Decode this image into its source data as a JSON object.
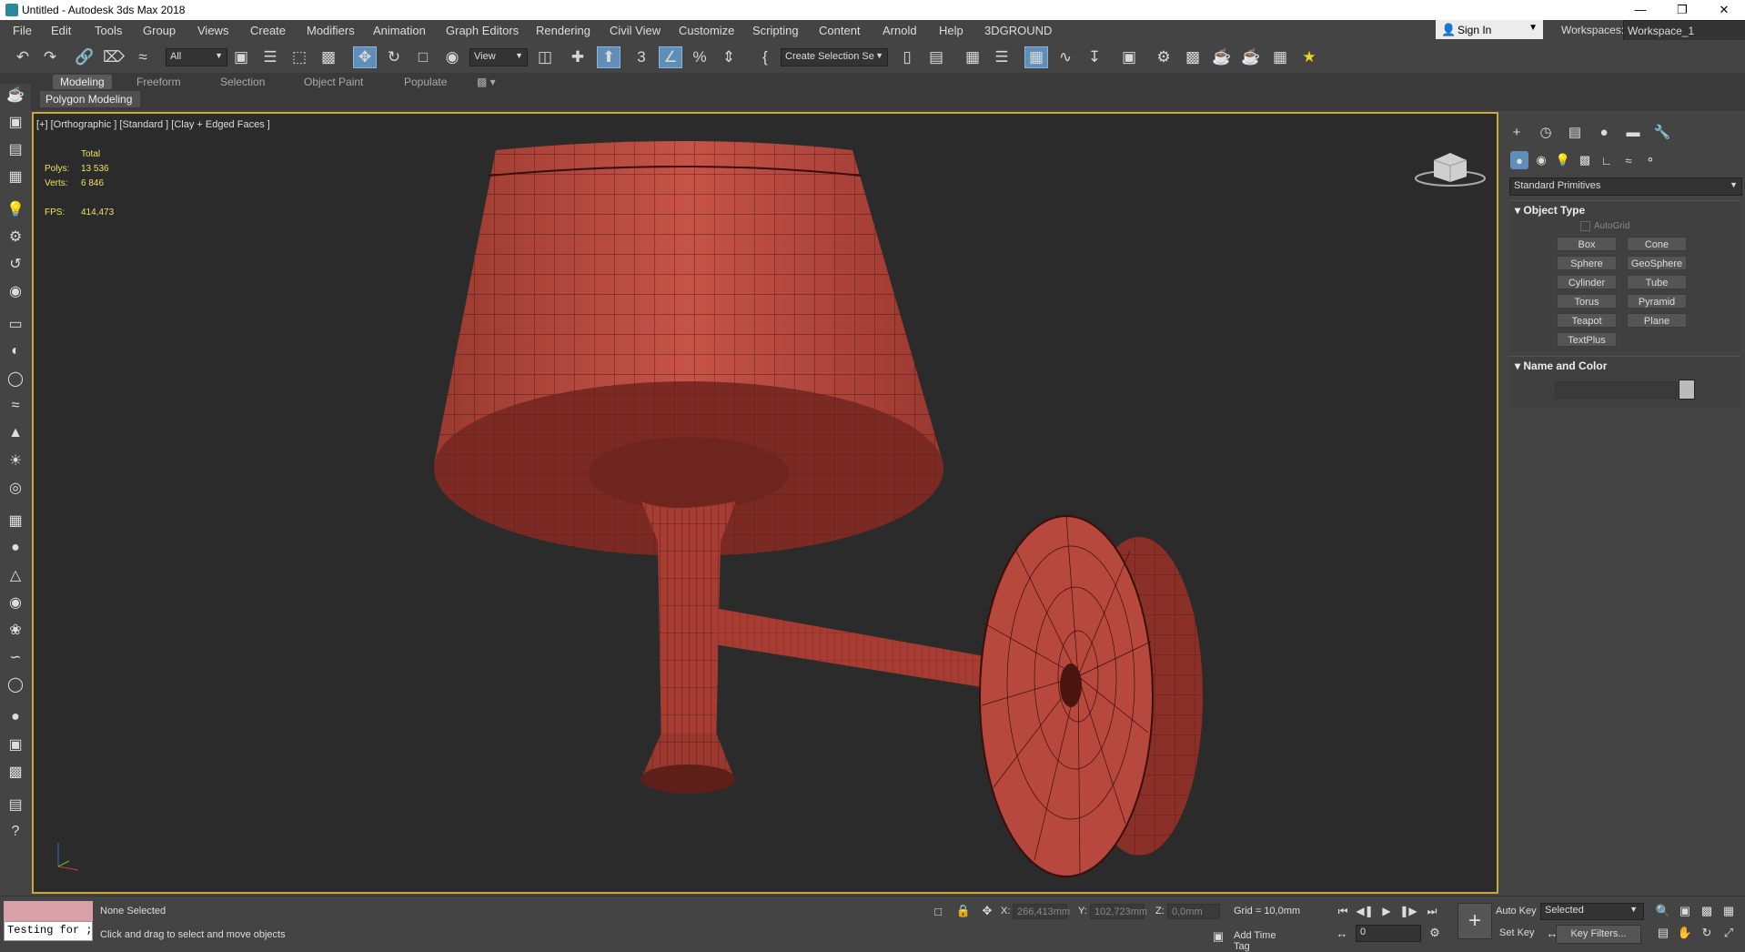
{
  "window": {
    "title": "Untitled - Autodesk 3ds Max 2018",
    "minimize": "—",
    "restore": "❐",
    "close": "✕"
  },
  "menubar": {
    "items": [
      "File",
      "Edit",
      "Tools",
      "Group",
      "Views",
      "Create",
      "Modifiers",
      "Animation",
      "Graph Editors",
      "Rendering",
      "Civil View",
      "Customize",
      "Scripting",
      "Content",
      "Arnold",
      "Help",
      "3DGROUND"
    ],
    "sign_in": "Sign In",
    "workspaces_label": "Workspaces:",
    "workspace_value": "Workspace_1"
  },
  "toolbar": {
    "filter_value": "All",
    "ref_coord_value": "View",
    "selection_set_value": "Create Selection Se"
  },
  "ribbon": {
    "tabs": [
      "Modeling",
      "Freeform",
      "Selection",
      "Object Paint",
      "Populate"
    ],
    "active_tab": "Modeling",
    "panel": "Polygon Modeling"
  },
  "viewport": {
    "label": "[+] [Orthographic ] [Standard ] [Clay + Edged Faces ]",
    "stats": {
      "total_label": "Total",
      "polys_label": "Polys:",
      "polys_value": "13 536",
      "verts_label": "Verts:",
      "verts_value": "6 846",
      "fps_label": "FPS:",
      "fps_value": "414,473"
    },
    "model_color": "#b8443a",
    "border_color": "#c7a93c"
  },
  "command_panel": {
    "category": "Standard Primitives",
    "object_type_title": "Object Type",
    "autogrid": "AutoGrid",
    "buttons": [
      "Box",
      "Cone",
      "Sphere",
      "GeoSphere",
      "Cylinder",
      "Tube",
      "Torus",
      "Pyramid",
      "Teapot",
      "Plane",
      "TextPlus"
    ],
    "name_color_title": "Name and Color"
  },
  "statusbar": {
    "maxscript_input": "Testing for ;",
    "selection_status": "None Selected",
    "prompt": "Click and drag to select and move objects",
    "x_label": "X:",
    "x_value": "266,413mm",
    "y_label": "Y:",
    "y_value": "102,723mm",
    "z_label": "Z:",
    "z_value": "0,0mm",
    "grid": "Grid = 10,0mm",
    "add_time_tag": "Add Time Tag",
    "frame_value": "0",
    "auto_key": "Auto Key",
    "set_key": "Set Key",
    "selected_value": "Selected",
    "key_filters": "Key Filters..."
  }
}
